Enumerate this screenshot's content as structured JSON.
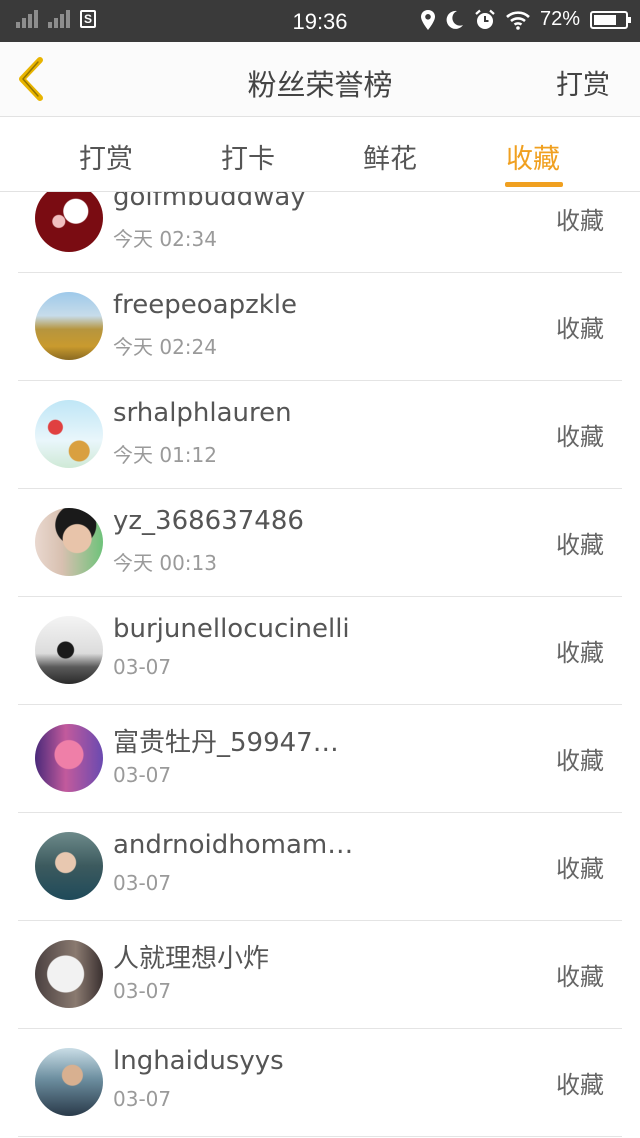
{
  "status_bar": {
    "time": "19:36",
    "battery": "72%",
    "battery_level": 0.72
  },
  "header": {
    "title": "粉丝荣誉榜",
    "action_label": "打赏"
  },
  "tabs": [
    {
      "label": "打赏",
      "active": false
    },
    {
      "label": "打卡",
      "active": false
    },
    {
      "label": "鲜花",
      "active": false
    },
    {
      "label": "收藏",
      "active": true
    }
  ],
  "colors": {
    "accent": "#f0a020",
    "status_bar": "#3a3a3a"
  },
  "list": [
    {
      "name": "golfmbuddway",
      "time": "今天 02:34",
      "action": "收藏"
    },
    {
      "name": "freepeoapzkle",
      "time": "今天 02:24",
      "action": "收藏"
    },
    {
      "name": "srhalphlauren",
      "time": "今天 01:12",
      "action": "收藏"
    },
    {
      "name": "yz_368637486",
      "time": "今天 00:13",
      "action": "收藏"
    },
    {
      "name": "burjunellocucinelli",
      "time": "03-07",
      "action": "收藏"
    },
    {
      "name": "富贵牡丹_59947…",
      "time": "03-07",
      "action": "收藏"
    },
    {
      "name": "andrnoidhomam…",
      "time": "03-07",
      "action": "收藏"
    },
    {
      "name": "人就理想小炸",
      "time": "03-07",
      "action": "收藏"
    },
    {
      "name": "lnghaidusyys",
      "time": "03-07",
      "action": "收藏"
    }
  ]
}
